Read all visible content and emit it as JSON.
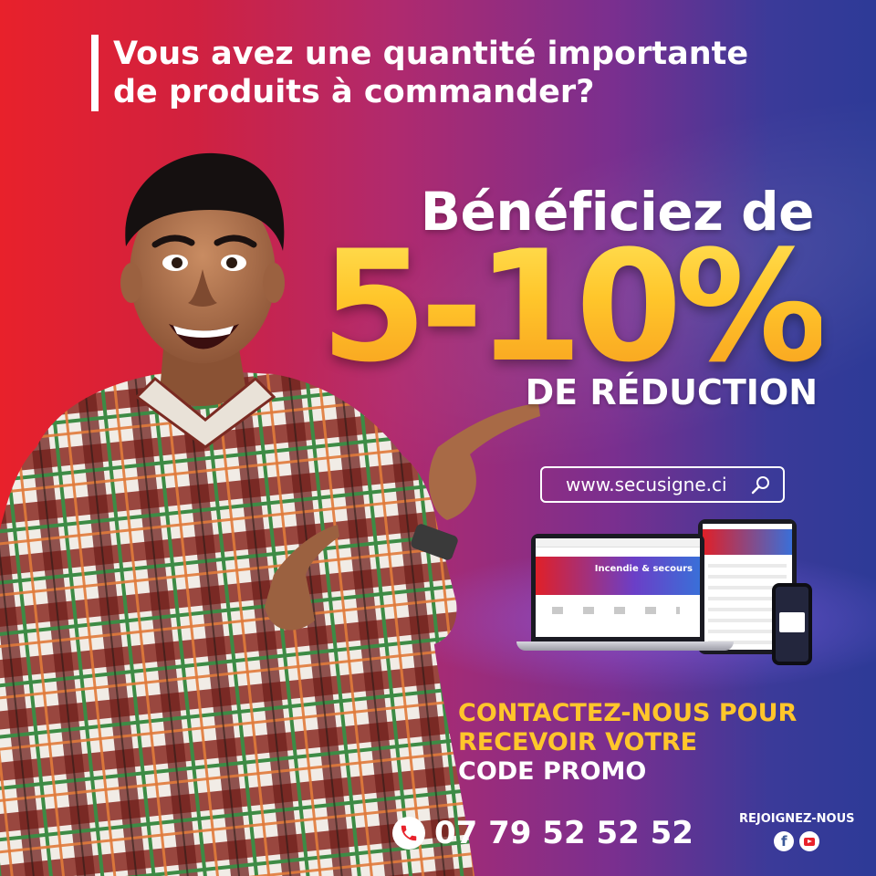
{
  "headline": {
    "line1": "Vous avez une quantité importante",
    "line2": "de produits à commander?"
  },
  "offer": {
    "intro": "Bénéficiez de",
    "percent": "5-10%",
    "label": "DE RÉDUCTION"
  },
  "website": {
    "url": "www.secusigne.ci"
  },
  "devices": {
    "screen_banner": "Incendie & secours"
  },
  "cta": {
    "line1": "CONTACTEZ-NOUS POUR",
    "line2": "RECEVOIR VOTRE",
    "line3": "CODE PROMO"
  },
  "phone": {
    "number": "07 79 52 52 52"
  },
  "social": {
    "label": "REJOIGNEZ-NOUS",
    "facebook_glyph": "f"
  },
  "colors": {
    "accent_yellow": "#ffc62b",
    "bg_red": "#e8212b",
    "bg_blue": "#2d3a97"
  }
}
